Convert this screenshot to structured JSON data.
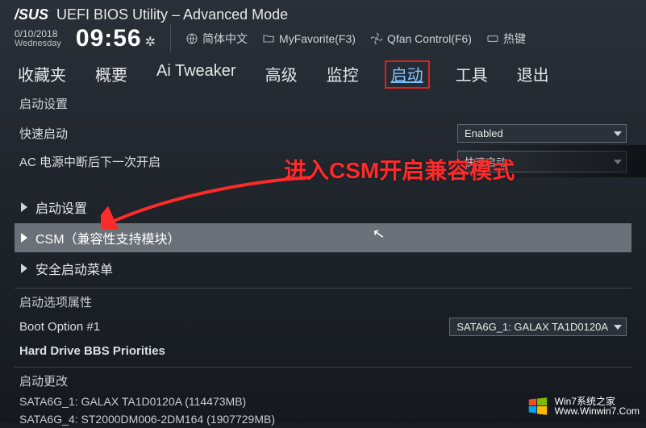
{
  "header": {
    "brand": "/SUS",
    "title": "UEFI BIOS Utility – Advanced Mode",
    "date": "0/10/2018",
    "day": "Wednesday",
    "time": "09:56",
    "language": "简体中文",
    "favorite": "MyFavorite(F3)",
    "qfan": "Qfan Control(F6)",
    "hotkey": "热键"
  },
  "tabs": {
    "items": [
      "收藏夹",
      "概要",
      "Ai Tweaker",
      "高级",
      "监控",
      "启动",
      "工具",
      "退出"
    ],
    "active_index": 5
  },
  "crumb": "启动设置",
  "fastboot": {
    "label": "快速启动",
    "value": "Enabled"
  },
  "ac_loss": {
    "label": "AC 电源中断后下一次开启",
    "value": "快速启动"
  },
  "sections": {
    "boot_config": "启动设置",
    "csm": "CSM（兼容性支持模块）",
    "secure_boot": "安全启动菜单"
  },
  "boot_option_header": "启动选项属性",
  "boot_option": {
    "label": "Boot Option #1",
    "value": "SATA6G_1: GALAX TA1D0120A"
  },
  "hdd_bbs": "Hard Drive BBS Priorities",
  "boot_override": {
    "header": "启动更改",
    "items": [
      "SATA6G_1: GALAX TA1D0120A  (114473MB)",
      "SATA6G_4: ST2000DM006-2DM164  (1907729MB)"
    ]
  },
  "annotation": "进入CSM开启兼容模式",
  "watermark": {
    "line1": "Win7系统之家",
    "line2": "Www.Winwin7.Com"
  }
}
